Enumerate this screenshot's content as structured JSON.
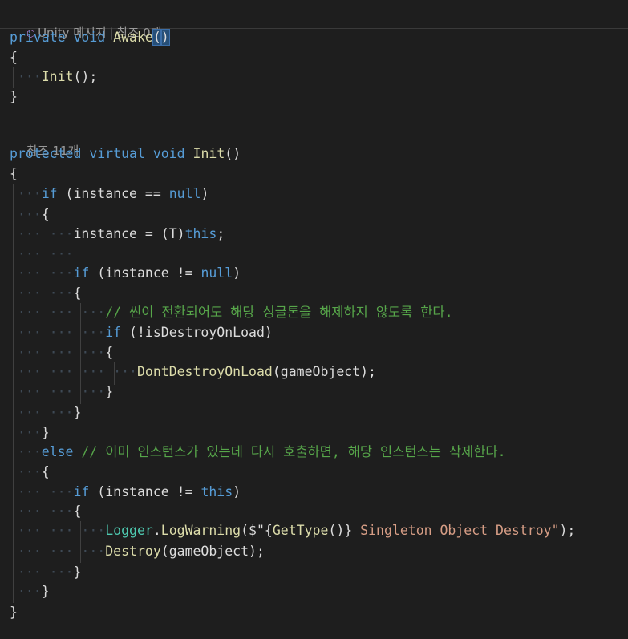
{
  "codelens": {
    "awake_unity": "Unity 메시지",
    "awake_refs": "참조 0개",
    "init_refs": "참조 11개"
  },
  "code": {
    "l1_kw1": "private",
    "l1_kw2": "void",
    "l1_name": "Awake",
    "l1_paren_open": "(",
    "l1_paren_close": ")",
    "l2": "{",
    "l3_call": "Init",
    "l3_rest": "();",
    "l4": "}",
    "l5_kw1": "protected",
    "l5_kw2": "virtual",
    "l5_kw3": "void",
    "l5_name": "Init",
    "l5_parens": "()",
    "l6": "{",
    "l7_if": "if",
    "l7_a": " (instance == ",
    "l7_null": "null",
    "l7_b": ")",
    "l8": "{",
    "l9_a": "instance = (T)",
    "l9_this": "this",
    "l9_b": ";",
    "l10_if": "if",
    "l10_a": " (instance != ",
    "l10_null": "null",
    "l10_b": ")",
    "l11": "{",
    "l12_comment": "// 씬이 전환되어도 해당 싱글톤을 해제하지 않도록 한다.",
    "l13_if": "if",
    "l13_a": " (!isDestroyOnLoad)",
    "l14": "{",
    "l15_fn": "DontDestroyOnLoad",
    "l15_a": "(gameObject);",
    "l16": "}",
    "l17": "}",
    "l18": "}",
    "l19_else": "else",
    "l19_comment": "// 이미 인스턴스가 있는데 다시 호출하면, 해당 인스턴스는 삭제한다.",
    "l20": "{",
    "l21_if": "if",
    "l21_a": " (instance != ",
    "l21_this": "this",
    "l21_b": ")",
    "l22": "{",
    "l23_cls": "Logger",
    "l23_dot": ".",
    "l23_fn": "LogWarning",
    "l23_a": "($\"{",
    "l23_gettype": "GetType",
    "l23_b": "()}",
    "l23_str": " Singleton Object Destroy\"",
    "l23_c": ");",
    "l24_fn": "Destroy",
    "l24_a": "(gameObject);",
    "l25": "}",
    "l26": "}",
    "l27": "}"
  }
}
